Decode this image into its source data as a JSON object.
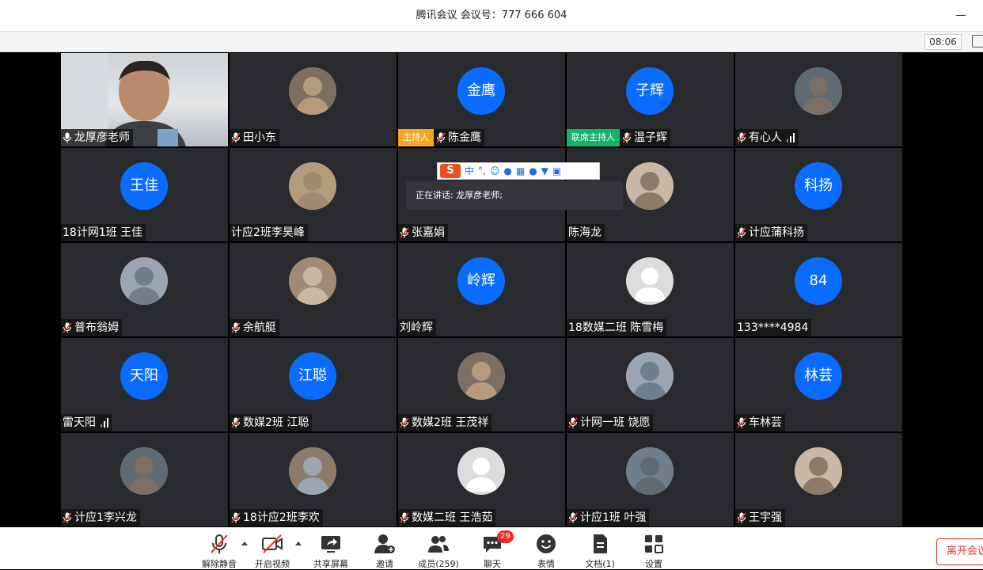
{
  "window": {
    "title": "腾讯会议 会议号：777 666 604"
  },
  "status": {
    "clock": "08:06"
  },
  "meeting": {
    "speaking": "正在讲话: 龙厚彦老师;",
    "ime_label": "中"
  },
  "participants": [
    {
      "name": "龙厚彦老师",
      "avatar": "video",
      "mic": "on"
    },
    {
      "name": "田小东",
      "avatar": "photo",
      "mic": "muted"
    },
    {
      "name": "陈金鹰",
      "avatar_text": "金鹰",
      "mic": "muted",
      "role": "主持人"
    },
    {
      "name": "温子辉",
      "avatar_text": "子辉",
      "mic": "muted",
      "role": "联席主持人"
    },
    {
      "name": "有心人",
      "avatar": "photo",
      "mic": "muted",
      "signal": true
    },
    {
      "name": "18计网1班 王佳",
      "avatar_text": "王佳"
    },
    {
      "name": "计应2班李昊峰",
      "avatar": "photo"
    },
    {
      "name": "张嘉娟",
      "avatar": "hidden",
      "mic": "muted"
    },
    {
      "name": "陈海龙",
      "avatar": "photo"
    },
    {
      "name": "计应蒲科扬",
      "avatar_text": "科扬",
      "mic": "muted"
    },
    {
      "name": "普布翁姆",
      "avatar": "photo",
      "mic": "muted"
    },
    {
      "name": "余航艇",
      "avatar": "photo",
      "mic": "muted"
    },
    {
      "name": "刘岭辉",
      "avatar_text": "岭辉"
    },
    {
      "name": "18数媒二班 陈雪梅",
      "avatar": "default"
    },
    {
      "name": "133****4984",
      "avatar_text": "84"
    },
    {
      "name": "雷天阳",
      "avatar_text": "天阳",
      "signal": true
    },
    {
      "name": "数媒2班 江聪",
      "avatar_text": "江聪",
      "mic": "muted"
    },
    {
      "name": "数媒2班 王茂祥",
      "avatar": "photo",
      "mic": "muted"
    },
    {
      "name": "计网一班 饶愿",
      "avatar": "photo",
      "mic": "muted"
    },
    {
      "name": "车林芸",
      "avatar_text": "林芸",
      "mic": "muted"
    },
    {
      "name": "计应1李兴龙",
      "avatar": "photo",
      "mic": "muted"
    },
    {
      "name": "18计应2班李欢",
      "avatar": "photo",
      "mic": "muted"
    },
    {
      "name": "数媒二班 王浩茹",
      "avatar": "default",
      "mic": "muted"
    },
    {
      "name": "计应1班  叶强",
      "avatar": "photo",
      "mic": "muted"
    },
    {
      "name": "王宇强",
      "avatar": "photo",
      "mic": "muted"
    }
  ],
  "toolbar": {
    "unmute": "解除静音",
    "video": "开启视频",
    "share": "共享屏幕",
    "invite": "邀请",
    "members": "成员(259)",
    "chat": "聊天",
    "chat_badge": "29",
    "reactions": "表情",
    "docs": "文档(1)",
    "settings": "设置",
    "leave": "离开会议"
  },
  "colors": {
    "avatar_blue": "#0a6cff",
    "host_badge": "#f5a623",
    "cohost_badge": "#17b26a",
    "tile_bg": "#292a2d"
  }
}
